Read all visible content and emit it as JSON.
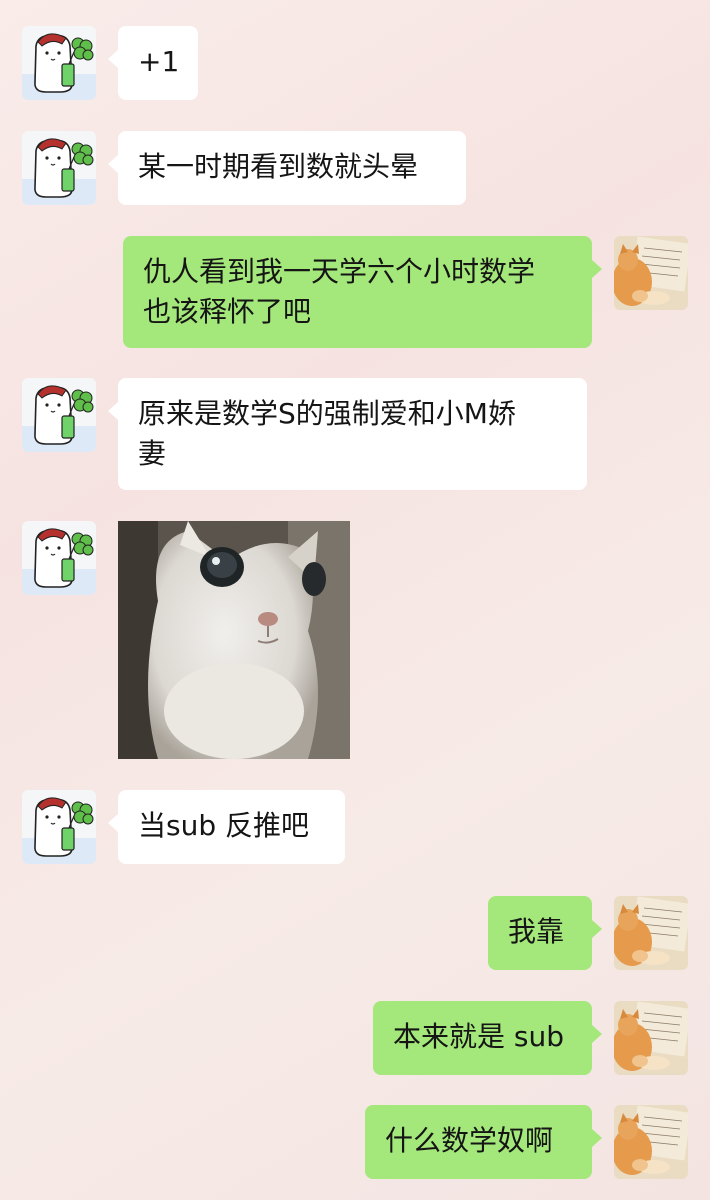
{
  "messages": [
    {
      "side": "in",
      "text": "+1"
    },
    {
      "side": "in",
      "text": "某一时期看到数就头晕"
    },
    {
      "side": "out",
      "text": "仇人看到我一天学六个小时数学\n也该释怀了吧"
    },
    {
      "side": "in",
      "text": "原来是数学S的强制爱和小M娇\n妻"
    },
    {
      "side": "in",
      "type": "image",
      "alt": "kitten-photo"
    },
    {
      "side": "in",
      "text": "当sub 反推吧"
    },
    {
      "side": "out",
      "text": "我靠"
    },
    {
      "side": "out",
      "text": "本来就是 sub"
    },
    {
      "side": "out",
      "text": "什么数学奴啊"
    }
  ],
  "colors": {
    "incoming_bubble": "#ffffff",
    "outgoing_bubble": "#a4e77a",
    "background": "#f7e8e5",
    "text": "#151515"
  },
  "icons": {
    "contact_avatar": "cartoon-cat-with-clover-avatar",
    "self_avatar": "cat-on-notebook-avatar"
  }
}
